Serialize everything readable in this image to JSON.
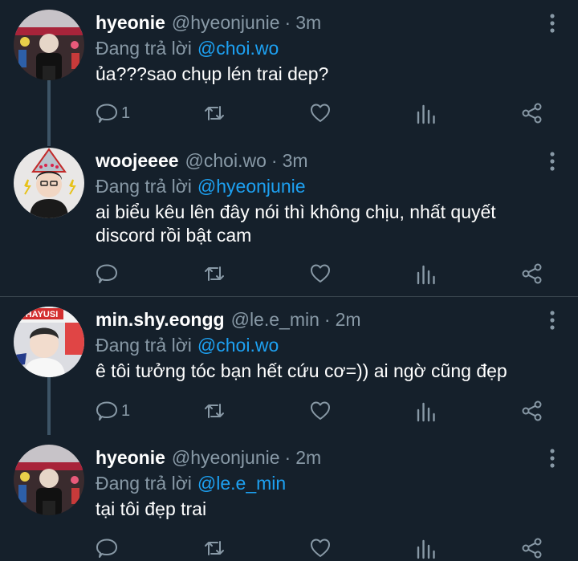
{
  "tweets": [
    {
      "name": "hyeonie",
      "handle": "@hyeonjunie",
      "time": "3m",
      "reply_prefix": "Đang trả lời",
      "reply_to": "@choi.wo",
      "text": "ủa???sao chụp lén trai dep?",
      "reply_count": "1",
      "avatar": "avatar-hyeonie"
    },
    {
      "name": "woojeeee",
      "handle": "@choi.wo",
      "time": "3m",
      "reply_prefix": "Đang trả lời",
      "reply_to": "@hyeonjunie",
      "text": "ai biểu kêu lên đây nói thì không chịu, nhất quyết discord rồi bật cam",
      "reply_count": "",
      "avatar": "avatar-woojeeee"
    },
    {
      "name": "min.shy.eongg",
      "handle": "@le.e_min",
      "time": "2m",
      "reply_prefix": "Đang trả lời",
      "reply_to": "@choi.wo",
      "text": "ê tôi tưởng tóc bạn hết cứu cơ=)) ai ngờ cũng đẹp",
      "reply_count": "1",
      "avatar": "avatar-min",
      "avatar_badge_text": "HAYUSI"
    },
    {
      "name": "hyeonie",
      "handle": "@hyeonjunie",
      "time": "2m",
      "reply_prefix": "Đang trả lời",
      "reply_to": "@le.e_min",
      "text": "tại tôi đẹp trai",
      "reply_count": "",
      "avatar": "avatar-hyeonie"
    }
  ],
  "separator": "·",
  "colors": {
    "background": "#15202b",
    "secondary_text": "#8899a6",
    "link": "#1da1f2",
    "divider": "#38444d",
    "thread_line": "#3d5466"
  }
}
